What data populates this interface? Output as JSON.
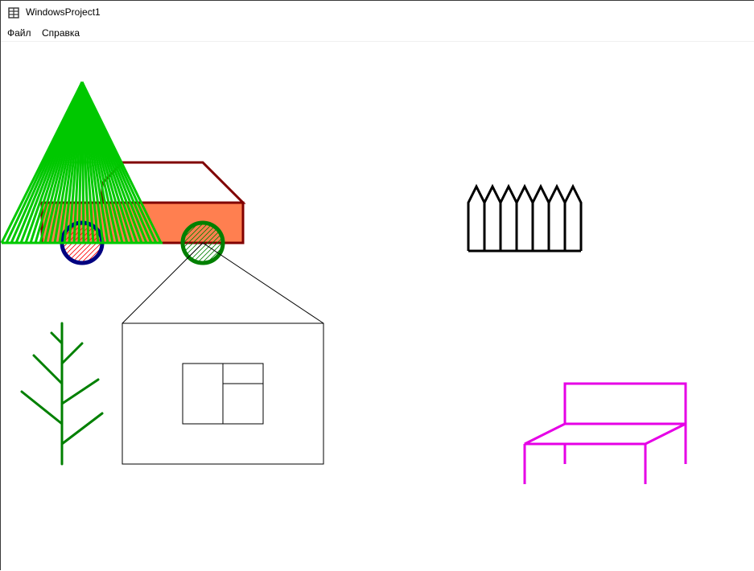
{
  "window": {
    "title": "WindowsProject1",
    "icon": "app-window-icon"
  },
  "menu": {
    "items": [
      {
        "label": "Файл"
      },
      {
        "label": "Справка"
      }
    ]
  },
  "colors": {
    "car_body": "#ff7f50",
    "car_outline": "#800000",
    "wheel_left_ring": "#000080",
    "wheel_left_hatch": "#ff0000",
    "wheel_right_ring": "#008000",
    "wheel_right_hatch": "#008000",
    "spruce": "#00c800",
    "branch_tree": "#008000",
    "house": "#000000",
    "fence": "#000000",
    "table": "#e600e6"
  }
}
